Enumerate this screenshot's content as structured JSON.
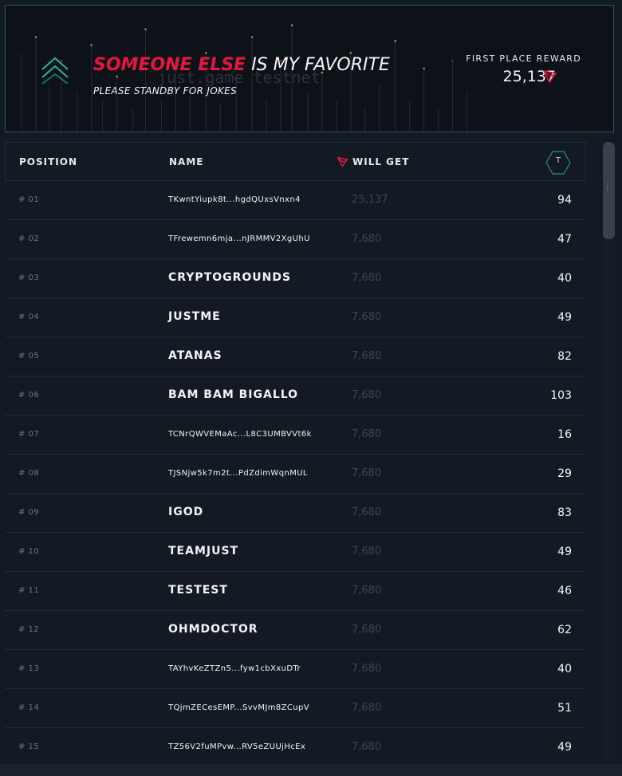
{
  "banner": {
    "title_accent": "SOMEONE ELSE",
    "title_rest": " IS MY FAVORITE",
    "subtitle": "PLEASE STANDBY FOR JOKES",
    "ghost_text": "just.game testnet",
    "reward_label": "FIRST PLACE REWARD",
    "reward_value": "25,137"
  },
  "table": {
    "headers": {
      "position": "POSITION",
      "name": "NAME",
      "will_get": "WILL GET",
      "token_button": "T"
    },
    "rows": [
      {
        "position": "# 01",
        "name": "TKwntYiupk8t...hgdQUxsVnxn4",
        "is_address": true,
        "will_get": "25,137",
        "score": "94"
      },
      {
        "position": "# 02",
        "name": "TFrewemn6mja...nJRMMV2XgUhU",
        "is_address": true,
        "will_get": "7,680",
        "score": "47"
      },
      {
        "position": "# 03",
        "name": "CRYPTOGROUNDS",
        "is_address": false,
        "will_get": "7,680",
        "score": "40"
      },
      {
        "position": "# 04",
        "name": "JUSTME",
        "is_address": false,
        "will_get": "7,680",
        "score": "49"
      },
      {
        "position": "# 05",
        "name": "ATANAS",
        "is_address": false,
        "will_get": "7,680",
        "score": "82"
      },
      {
        "position": "# 06",
        "name": "BAM BAM BIGALLO",
        "is_address": false,
        "will_get": "7,680",
        "score": "103"
      },
      {
        "position": "# 07",
        "name": "TCNrQWVEMaAc...L8C3UMBVVt6k",
        "is_address": true,
        "will_get": "7,680",
        "score": "16"
      },
      {
        "position": "# 08",
        "name": "TJSNjw5k7m2t...PdZdimWqnMUL",
        "is_address": true,
        "will_get": "7,680",
        "score": "29"
      },
      {
        "position": "# 09",
        "name": "IGOD",
        "is_address": false,
        "will_get": "7,680",
        "score": "83"
      },
      {
        "position": "# 10",
        "name": "TEAMJUST",
        "is_address": false,
        "will_get": "7,680",
        "score": "49"
      },
      {
        "position": "# 11",
        "name": "TESTEST",
        "is_address": false,
        "will_get": "7,680",
        "score": "46"
      },
      {
        "position": "# 12",
        "name": "OHMDOCTOR",
        "is_address": false,
        "will_get": "7,680",
        "score": "62"
      },
      {
        "position": "# 13",
        "name": "TAYhvKeZTZn5...fyw1cbXxuDTr",
        "is_address": true,
        "will_get": "7,680",
        "score": "40"
      },
      {
        "position": "# 14",
        "name": "TQjmZECesEMP...SvvMJm8ZCupV",
        "is_address": true,
        "will_get": "7,680",
        "score": "51"
      },
      {
        "position": "# 15",
        "name": "TZ56V2fuMPvw...RV5eZUUjHcEx",
        "is_address": true,
        "will_get": "7,680",
        "score": "49"
      }
    ]
  },
  "colors": {
    "accent_red": "#e8163f",
    "teal": "#2fb38f",
    "background": "#141a24"
  },
  "icons": {
    "logo": "double-chevron-up-icon",
    "currency": "tron-icon",
    "token_button": "hexagon-icon"
  }
}
